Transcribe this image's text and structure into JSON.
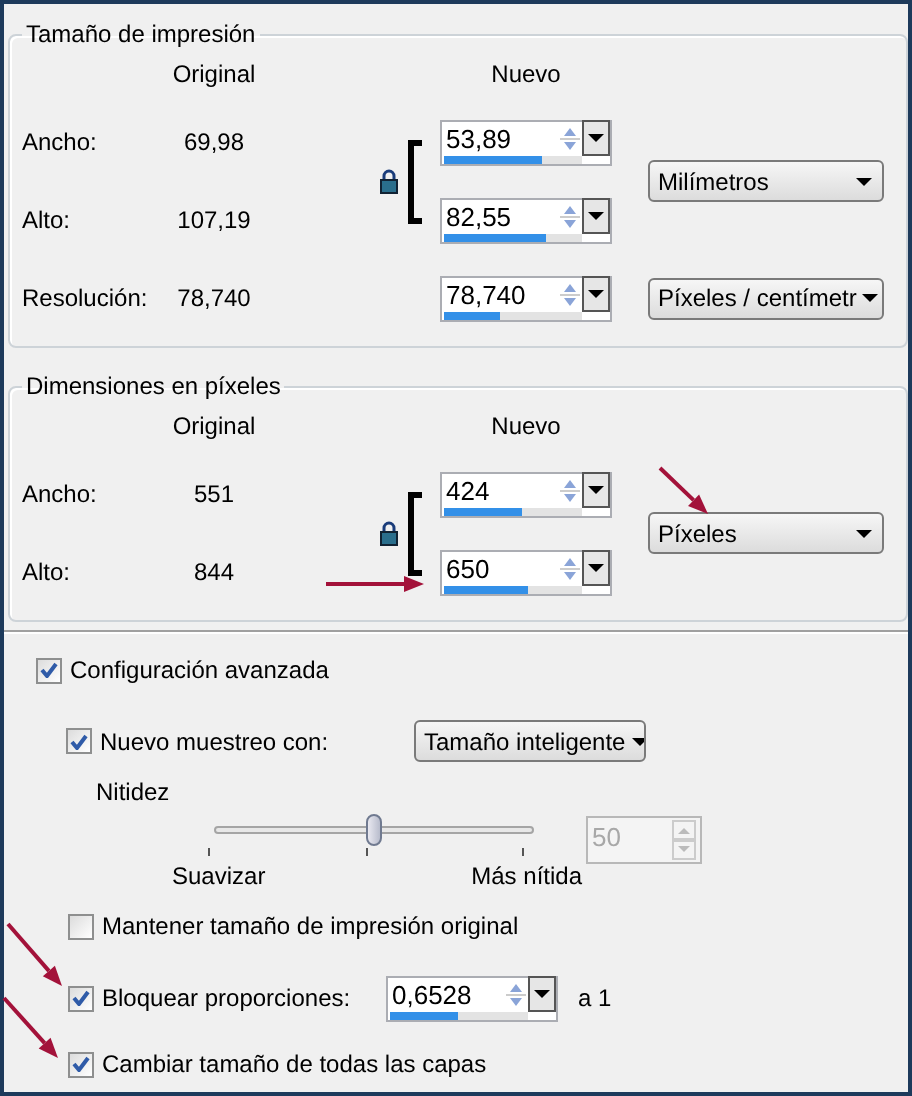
{
  "print_size": {
    "title": "Tamaño de impresión",
    "header_original": "Original",
    "header_new": "Nuevo",
    "linked": true,
    "rows": [
      {
        "label": "Ancho:",
        "original": "69,98",
        "value": "53,89",
        "level": 0.71
      },
      {
        "label": "Alto:",
        "original": "107,19",
        "value": "82,55",
        "level": 0.74
      }
    ],
    "units": "Milímetros",
    "resolution": {
      "label": "Resolución:",
      "original": "78,740",
      "value": "78,740",
      "level": 0.41,
      "units": "Píxeles / centímetr"
    }
  },
  "pixel_dimensions": {
    "title": "Dimensiones en píxeles",
    "header_original": "Original",
    "header_new": "Nuevo",
    "linked": true,
    "rows": [
      {
        "label": "Ancho:",
        "original": "551",
        "value": "424",
        "level": 0.57
      },
      {
        "label": "Alto:",
        "original": "844",
        "value": "650",
        "level": 0.61
      }
    ],
    "units": "Píxeles"
  },
  "advanced": {
    "label": "Configuración avanzada",
    "checked": true
  },
  "resample": {
    "label": "Nuevo muestreo con:",
    "checked": true,
    "method": "Tamaño inteligente"
  },
  "sharpness": {
    "label": "Nitidez",
    "level": 0.5,
    "min_label": "Suavizar",
    "max_label": "Más nítida",
    "value": "50",
    "disabled": true
  },
  "maintain_print_size": {
    "label": "Mantener tamaño de impresión original",
    "checked": false
  },
  "lock_ratio": {
    "label": "Bloquear proporciones:",
    "checked": true,
    "value": "0,6528",
    "level": 0.49,
    "suffix": "a 1"
  },
  "resize_all_layers": {
    "label": "Cambiar tamaño de todas las capas",
    "checked": true
  }
}
